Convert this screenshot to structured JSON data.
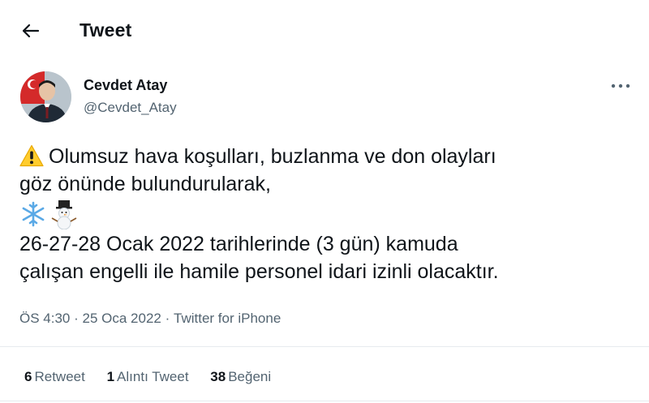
{
  "header": {
    "title": "Tweet"
  },
  "author": {
    "name": "Cevdet Atay",
    "handle": "@Cevdet_Atay"
  },
  "tweet": {
    "line1": "Olumsuz hava koşulları, buzlanma ve don olayları",
    "line2": "göz önünde bulundurularak,",
    "line3": "26-27-28 Ocak 2022 tarihlerinde (3 gün) kamuda",
    "line4": "çalışan engelli ile hamile personel idari izinli olacaktır.",
    "icons": [
      "warning-icon",
      "snowflake-icon",
      "snowman-icon"
    ]
  },
  "meta": {
    "time": "ÖS 4:30",
    "date": "25 Oca 2022",
    "source": "Twitter for iPhone",
    "dot": "·"
  },
  "stats": {
    "retweets": "6",
    "retweets_label": "Retweet",
    "quotes": "1",
    "quotes_label": "Alıntı Tweet",
    "likes": "38",
    "likes_label": "Beğeni"
  },
  "colors": {
    "text": "#0f1419",
    "secondary": "#536471",
    "divider": "#e7eaee",
    "warning": "#ffcc2e"
  }
}
